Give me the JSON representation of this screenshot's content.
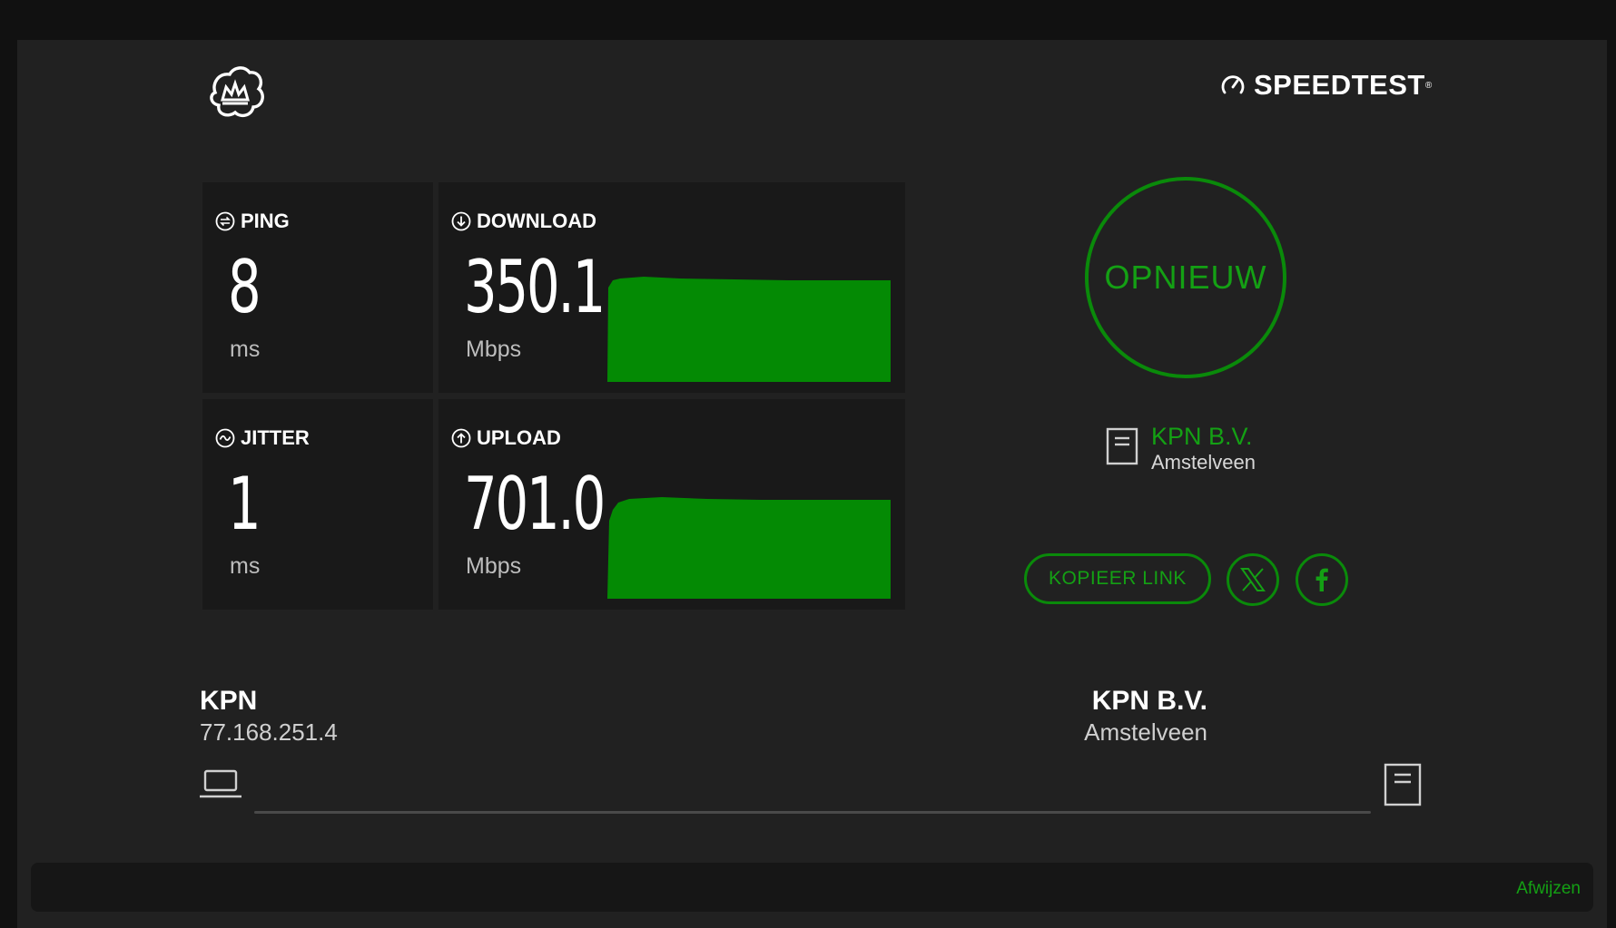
{
  "brand": {
    "name": "SPEEDTEST",
    "trademark": "®"
  },
  "results": {
    "ping": {
      "label": "PING",
      "value": "8",
      "unit": "ms"
    },
    "download": {
      "label": "DOWNLOAD",
      "value": "350.1",
      "unit": "Mbps"
    },
    "jitter": {
      "label": "JITTER",
      "value": "1",
      "unit": "ms"
    },
    "upload": {
      "label": "UPLOAD",
      "value": "701.0",
      "unit": "Mbps"
    }
  },
  "actions": {
    "restart_label": "OPNIEUW",
    "copy_link_label": "KOPIEER LINK",
    "share_x_icon": "x-logo-icon",
    "share_facebook_icon": "facebook-icon"
  },
  "server": {
    "name": "KPN B.V.",
    "location": "Amstelveen"
  },
  "connection": {
    "client_isp": "KPN",
    "client_ip": "77.168.251.4",
    "server_name": "KPN B.V.",
    "server_location": "Amstelveen"
  },
  "banner": {
    "dismiss_label": "Afwijzen"
  },
  "colors": {
    "accent": "#0a8a0a",
    "graph_fill": "#048a04",
    "background": "#212121",
    "card": "#191919"
  }
}
